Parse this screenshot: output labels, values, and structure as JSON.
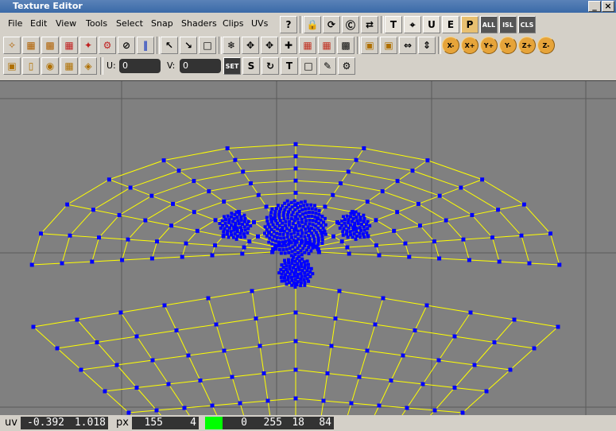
{
  "window": {
    "title": "Texture Editor"
  },
  "menu": [
    "File",
    "Edit",
    "View",
    "Tools",
    "Select",
    "Snap",
    "Shaders",
    "Clips",
    "UVs"
  ],
  "toolbar": {
    "all_label": "ALL",
    "isl_label": "ISL",
    "cls_label": "CLS",
    "set_label": "SET",
    "axis_buttons": [
      "X-",
      "X+",
      "Y+",
      "Y-",
      "Z+",
      "Z-"
    ],
    "text_buttons": [
      "?",
      "T",
      "U",
      "E",
      "P",
      "S",
      "T"
    ]
  },
  "fields": {
    "u_label": "U:",
    "u_value": "0",
    "v_label": "V:",
    "v_value": "0"
  },
  "status": {
    "uv_label": "uv",
    "uv_u": "-0.392",
    "uv_v": "1.018",
    "px_label": "px",
    "px_x": "155",
    "px_y": "4",
    "color_r": "0",
    "color_g": "255",
    "color_b": "18",
    "color_a": "84"
  },
  "colors": {
    "viewport_bg": "#808080",
    "mesh_line": "#ffff00",
    "vertex": "#0000ff",
    "grid": "#5a5a5a",
    "title_bar": "#4a76b0",
    "swatch": "#00ff00"
  }
}
